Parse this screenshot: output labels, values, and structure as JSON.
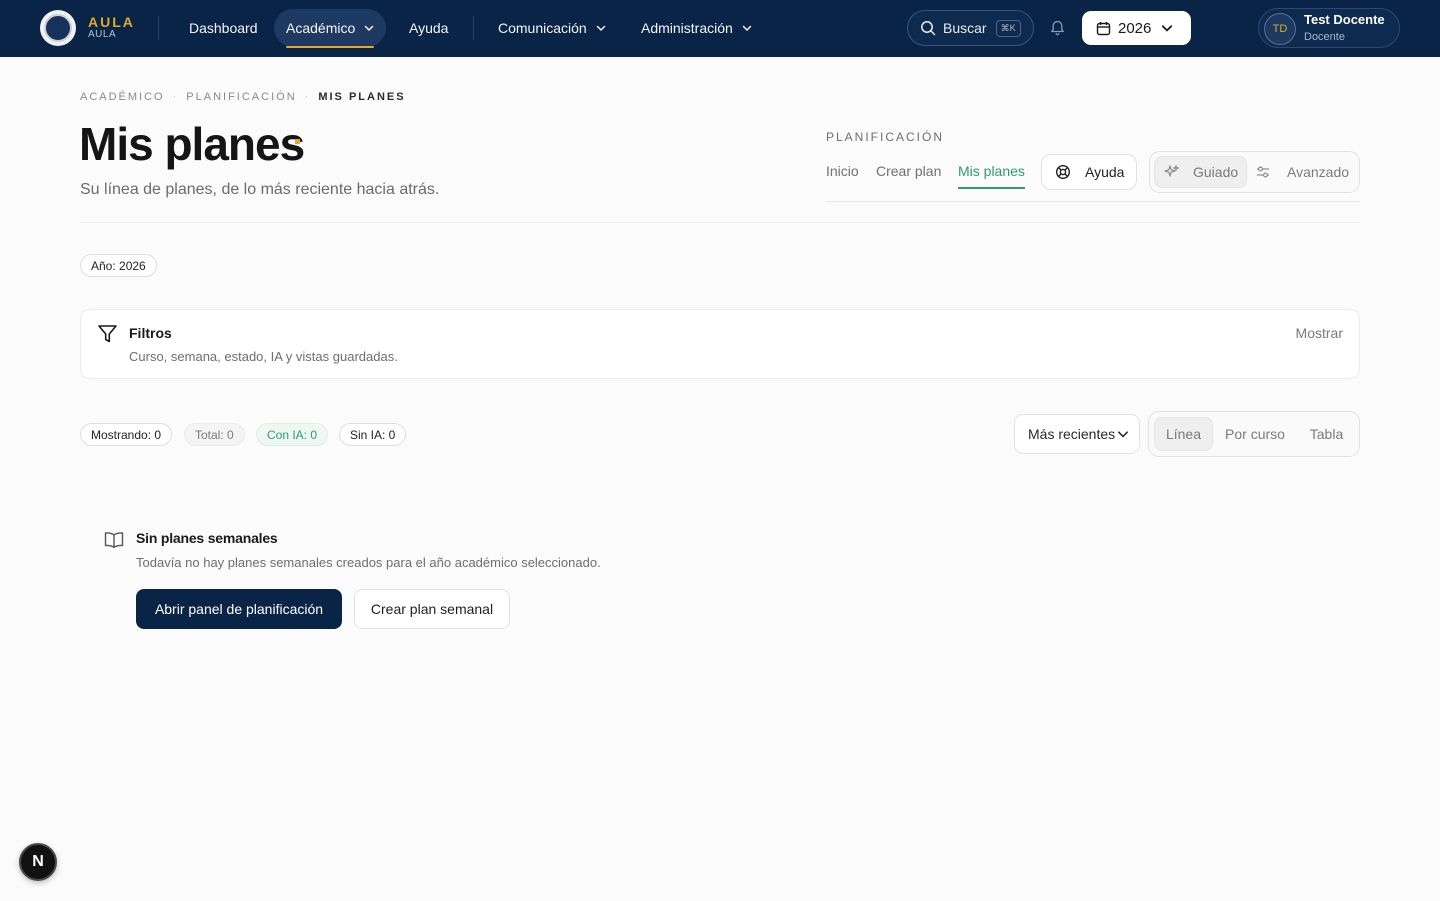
{
  "brand": {
    "name": "AULA",
    "sub": "AULA"
  },
  "nav": {
    "items": [
      {
        "label": "Dashboard"
      },
      {
        "label": "Académico"
      },
      {
        "label": "Ayuda"
      },
      {
        "label": "Comunicación"
      },
      {
        "label": "Administración"
      }
    ],
    "search_label": "Buscar",
    "search_shortcut": "⌘K",
    "year": "2026",
    "user": {
      "initials": "TD",
      "name": "Test Docente",
      "role": "Docente"
    }
  },
  "breadcrumb": [
    "ACADÉMICO",
    "PLANIFICACIÓN",
    "MIS PLANES"
  ],
  "page": {
    "title": "Mis planes",
    "subtitle": "Su línea de planes, de lo más reciente hacia atrás."
  },
  "planning": {
    "section_label": "PLANIFICACIÓN",
    "tabs": [
      {
        "label": "Inicio"
      },
      {
        "label": "Crear plan"
      },
      {
        "label": "Mis planes"
      }
    ],
    "help_label": "Ayuda",
    "modes": [
      {
        "label": "Guiado"
      },
      {
        "label": "Avanzado"
      }
    ]
  },
  "year_chip": "Año: 2026",
  "filters": {
    "title": "Filtros",
    "subtitle": "Curso, semana, estado, IA y vistas guardadas.",
    "toggle_label": "Mostrar"
  },
  "stats": {
    "showing": "Mostrando: 0",
    "total": "Total: 0",
    "with_ai": "Con IA: 0",
    "without_ai": "Sin IA: 0"
  },
  "sort_label": "Más recientes",
  "views": [
    {
      "label": "Línea"
    },
    {
      "label": "Por curso"
    },
    {
      "label": "Tabla"
    }
  ],
  "empty": {
    "title": "Sin planes semanales",
    "description": "Todavía no hay planes semanales creados para el año académico seleccionado.",
    "primary_button": "Abrir panel de planificación",
    "secondary_button": "Crear plan semanal"
  },
  "dev_badge": "N",
  "colors": {
    "navbar": "#0a2447",
    "accent": "#e0a82e",
    "green": "#2e9b74",
    "primary_button": "#0a2447"
  }
}
